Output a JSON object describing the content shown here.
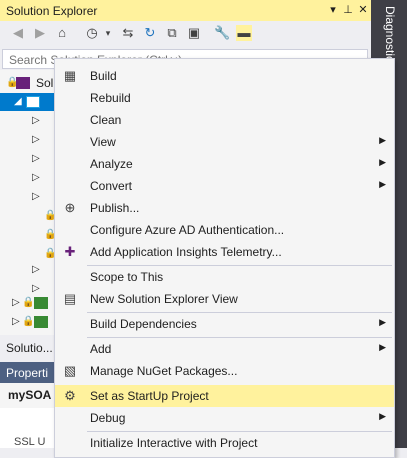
{
  "solution_explorer": {
    "title": "Solution Explorer",
    "pin_glyph": "⊥",
    "search_placeholder": "Search Solution Explorer (Ctrl+;)",
    "footer_label": "Solutio...",
    "tree": {
      "solution_label": "Sol"
    }
  },
  "side_tab": {
    "label": "Diagnostic"
  },
  "properties": {
    "title": "Properti",
    "object": "mySOA",
    "row_label": "SSL U"
  },
  "context_menu": {
    "items": {
      "build": "Build",
      "rebuild": "Rebuild",
      "clean": "Clean",
      "view": "View",
      "analyze": "Analyze",
      "convert": "Convert",
      "publish": "Publish...",
      "azure_ad": "Configure Azure AD Authentication...",
      "app_insights": "Add Application Insights Telemetry...",
      "scope": "Scope to This",
      "new_se_view": "New Solution Explorer View",
      "build_deps": "Build Dependencies",
      "add": "Add",
      "nuget": "Manage NuGet Packages...",
      "startup": "Set as StartUp Project",
      "debug": "Debug",
      "interactive": "Initialize Interactive with Project"
    },
    "submenu_arrow": "▶"
  },
  "colors": {
    "highlight": "#fff29d",
    "props_title_bg": "#4d6082",
    "accent_lock": "#1ba1e2"
  }
}
